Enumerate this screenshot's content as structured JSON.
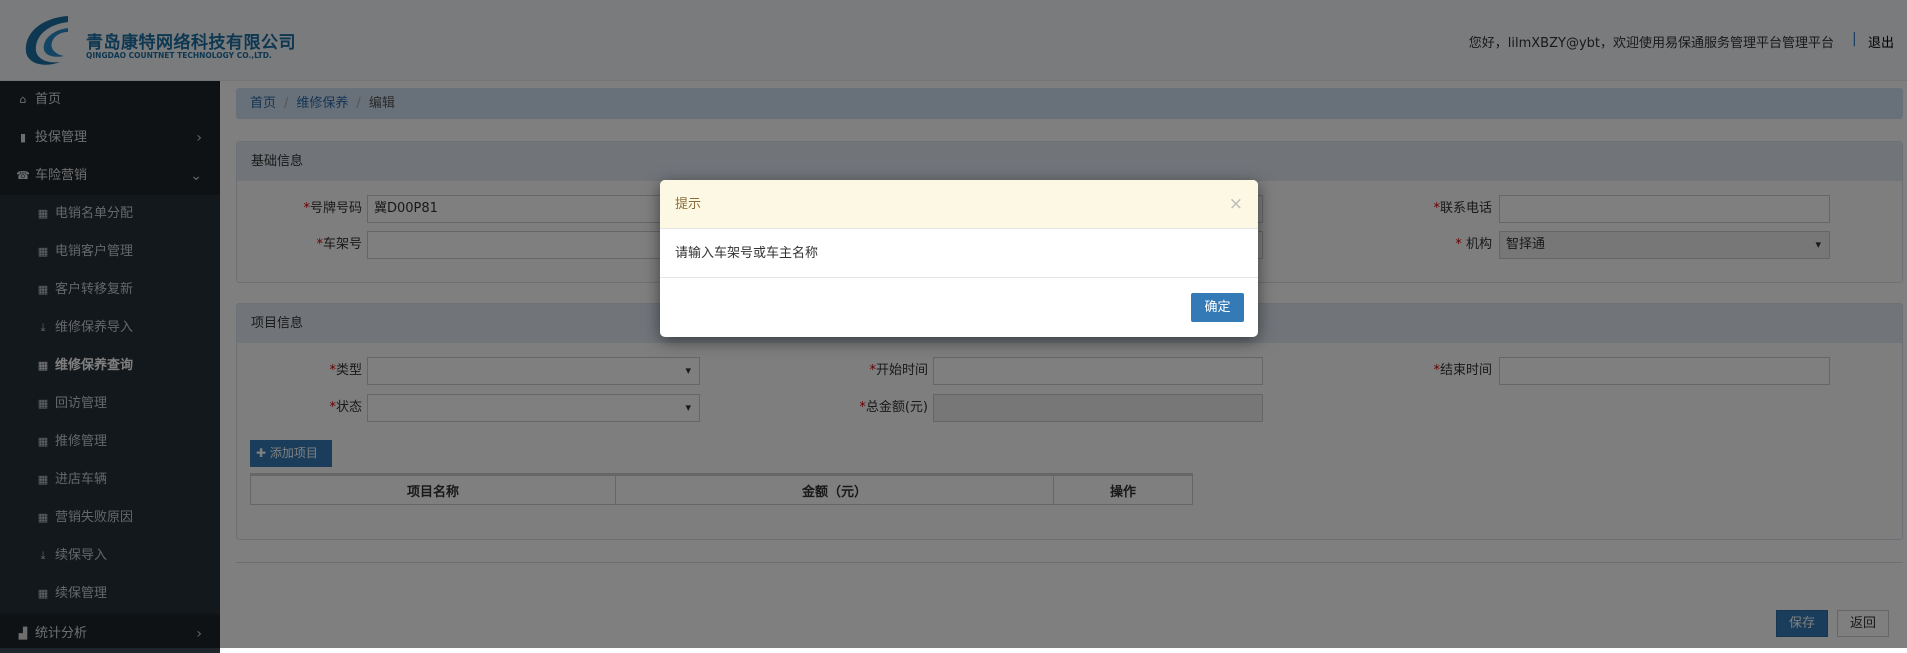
{
  "header": {
    "company_cn": "青岛康特网络科技有限公司",
    "company_en": "QINGDAO COUNTNET TECHNOLOGY CO.,LTD.",
    "welcome": "您好，lilmXBZY@ybt，欢迎使用易保通服务管理平台管理平台",
    "separator": "|",
    "logout": "退出"
  },
  "sidebar": {
    "items": [
      {
        "label": "首页"
      },
      {
        "label": "投保管理"
      },
      {
        "label": "车险营销"
      },
      {
        "label": "电销名单分配"
      },
      {
        "label": "电销客户管理"
      },
      {
        "label": "客户转移复新"
      },
      {
        "label": "维修保养导入"
      },
      {
        "label": "维修保养查询"
      },
      {
        "label": "回访管理"
      },
      {
        "label": "推修管理"
      },
      {
        "label": "进店车辆"
      },
      {
        "label": "营销失败原因"
      },
      {
        "label": "续保导入"
      },
      {
        "label": "续保管理"
      },
      {
        "label": "统计分析"
      }
    ]
  },
  "breadcrumb": {
    "items": [
      "首页",
      "维修保养",
      "编辑"
    ],
    "divider": "/"
  },
  "basic": {
    "title": "基础信息",
    "plate_label": "号牌号码",
    "plate_value": "冀D00P81",
    "vin_label": "车架号",
    "phone_label": "联系电话",
    "org_label": "机构",
    "org_value": "智择通",
    "required": "*"
  },
  "project": {
    "title": "项目信息",
    "type_label": "类型",
    "start_label": "开始时间",
    "end_label": "结束时间",
    "status_label": "状态",
    "total_label": "总金额(元)",
    "add_label": "添加项目",
    "columns": [
      "项目名称",
      "金额（元）",
      "操作"
    ]
  },
  "actions": {
    "save": "保存",
    "back": "返回"
  },
  "modal": {
    "title": "提示",
    "message": "请输入车架号或车主名称",
    "ok": "确定",
    "close": "×"
  }
}
